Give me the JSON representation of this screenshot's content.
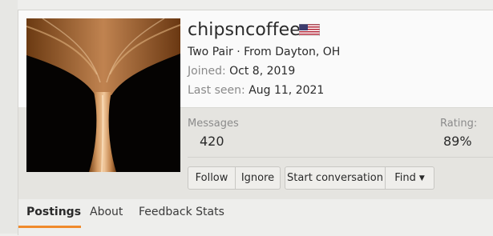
{
  "profile": {
    "username": "chipsncoffee",
    "flag_icon": "us-flag-icon",
    "rank": "Two Pair",
    "location_sep": " · ",
    "location_prefix": "From",
    "location": "Dayton, OH",
    "joined_label": "Joined:",
    "joined_value": "Oct 8, 2019",
    "last_seen_label": "Last seen:",
    "last_seen_value": "Aug 11, 2021"
  },
  "stats": {
    "messages_label": "Messages",
    "messages_value": "420",
    "rating_label": "Rating:",
    "rating_value": "89%"
  },
  "buttons": {
    "follow": "Follow",
    "ignore": "Ignore",
    "start_conversation": "Start conversation",
    "find": "Find"
  },
  "tabs": [
    {
      "label": "Postings",
      "active": true
    },
    {
      "label": "About",
      "active": false
    },
    {
      "label": "Feedback Stats",
      "active": false
    }
  ],
  "colors": {
    "accent": "#f08a2c",
    "flag_red": "#b22234",
    "flag_blue": "#3c3b6e"
  }
}
